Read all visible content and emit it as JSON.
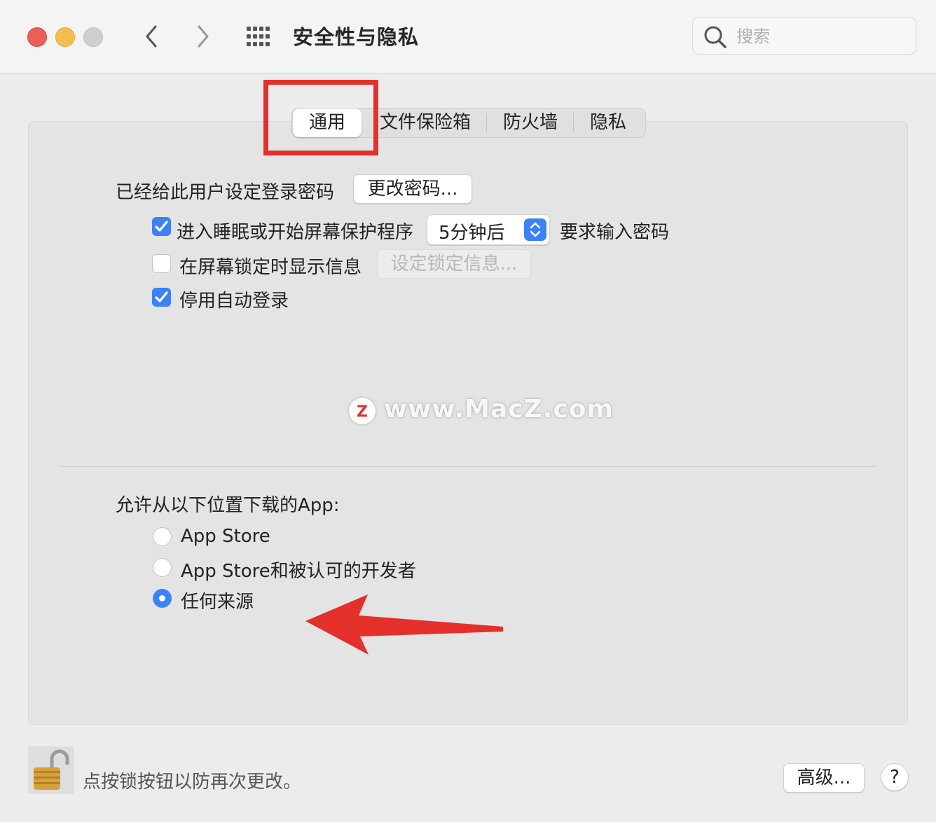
{
  "window": {
    "title": "安全性与隐私",
    "search_placeholder": "搜索"
  },
  "tabs": [
    {
      "label": "通用",
      "active": true
    },
    {
      "label": "文件保险箱",
      "active": false
    },
    {
      "label": "防火墙",
      "active": false
    },
    {
      "label": "隐私",
      "active": false
    }
  ],
  "general": {
    "password_set_label": "已经给此用户设定登录密码",
    "change_password_button": "更改密码...",
    "require_password": {
      "checked": true,
      "label": "进入睡眠或开始屏幕保护程序",
      "delay_value": "5分钟后",
      "suffix": "要求输入密码"
    },
    "lock_message": {
      "checked": false,
      "label": "在屏幕锁定时显示信息",
      "button": "设定锁定信息..."
    },
    "disable_autologin": {
      "checked": true,
      "label": "停用自动登录"
    }
  },
  "watermark": {
    "badge": "Z",
    "text": "www.MacZ.com"
  },
  "downloads": {
    "heading": "允许从以下位置下载的App:",
    "options": [
      {
        "label": "App Store",
        "selected": false
      },
      {
        "label": "App Store和被认可的开发者",
        "selected": false
      },
      {
        "label": "任何来源",
        "selected": true
      }
    ]
  },
  "footer": {
    "lock_text": "点按锁按钮以防再次更改。",
    "advanced_button": "高级...",
    "help_button": "?"
  },
  "colors": {
    "accent": "#3a82f6",
    "annotation": "#e4302a"
  }
}
